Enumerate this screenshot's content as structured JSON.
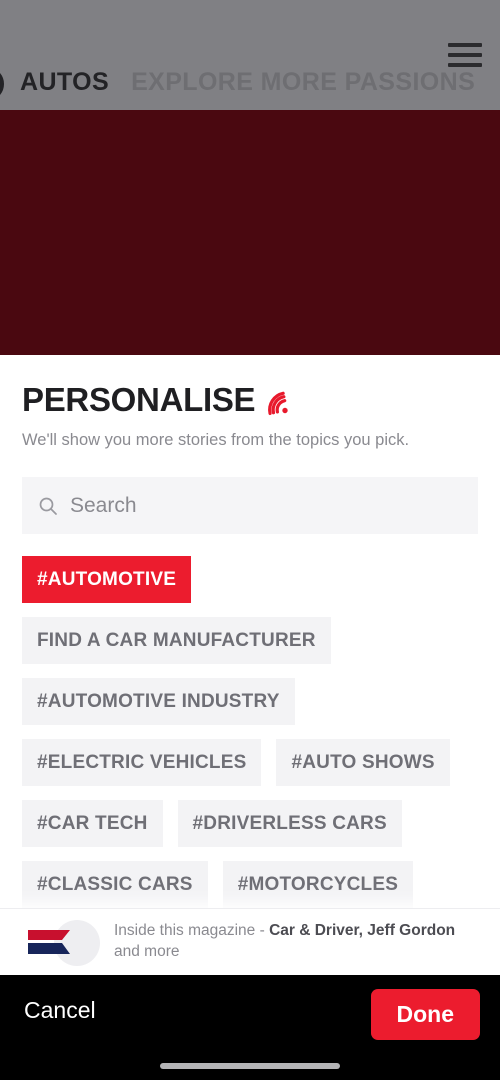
{
  "colors": {
    "accent_red": "#ec1c2e",
    "hero_maroon": "#4a0810",
    "dim_overlay_gray": "#808084",
    "chip_background": "#f3f3f5",
    "chip_text": "#6f6f76",
    "action_bar_black": "#000000"
  },
  "top_nav": {
    "logo_icon": "circle-logo-icon",
    "title": "AUTOS",
    "secondary_title": "EXPLORE MORE PASSIONS",
    "menu_icon": "hamburger-menu-icon"
  },
  "sheet": {
    "title": "PERSONALISE",
    "title_icon": "signal-wifi-icon",
    "subtitle": "We'll show you more stories from the topics you pick.",
    "search": {
      "icon": "search-icon",
      "placeholder": "Search",
      "value": ""
    },
    "tag_rows": [
      [
        {
          "label": "#AUTOMOTIVE",
          "selected": true
        }
      ],
      [
        {
          "label": "FIND A CAR MANUFACTURER",
          "selected": false
        }
      ],
      [
        {
          "label": "#AUTOMOTIVE INDUSTRY",
          "selected": false
        }
      ],
      [
        {
          "label": "#ELECTRIC VEHICLES",
          "selected": false
        },
        {
          "label": "#AUTO SHOWS",
          "selected": false
        }
      ],
      [
        {
          "label": "#CAR TECH",
          "selected": false
        },
        {
          "label": "#DRIVERLESS CARS",
          "selected": false
        }
      ],
      [
        {
          "label": "#CLASSIC CARS",
          "selected": false
        },
        {
          "label": "#MOTORCYCLES",
          "selected": false
        }
      ]
    ],
    "magazine": {
      "icon": "magazine-flag-icon",
      "prefix": "Inside this magazine - ",
      "names": "Car & Driver, Jeff Gordon",
      "suffix": " and more"
    }
  },
  "action_bar": {
    "cancel_label": "Cancel",
    "done_label": "Done",
    "home_indicator": "home-indicator"
  }
}
